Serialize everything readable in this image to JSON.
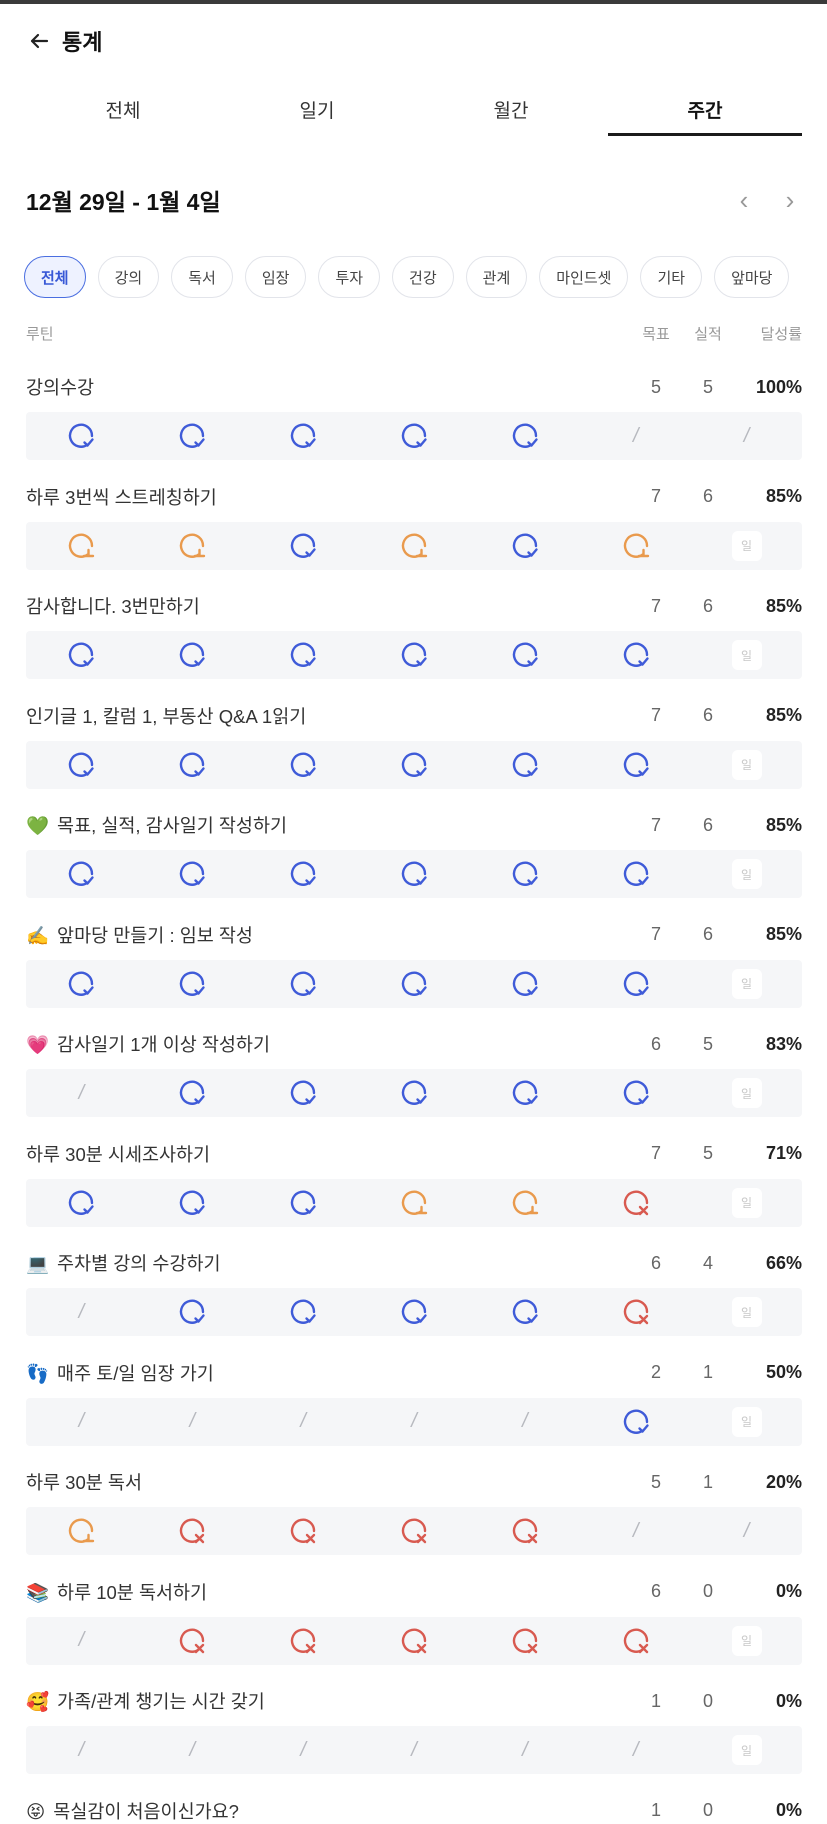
{
  "header": {
    "title": "통계",
    "back_icon": "arrow-left-icon"
  },
  "tabs": [
    "전체",
    "일기",
    "월간",
    "주간"
  ],
  "active_tab": 3,
  "date_range": "12월 29일 - 1월 4일",
  "chips": [
    "전체",
    "강의",
    "독서",
    "임장",
    "투자",
    "건강",
    "관계",
    "마인드셋",
    "기타",
    "앞마당"
  ],
  "active_chip": 0,
  "columns": {
    "routine": "루틴",
    "goal": "목표",
    "actual": "실적",
    "rate": "달성률"
  },
  "colors": {
    "accent": "#3f5bd8",
    "partial": "#e99a4d",
    "fail": "#d85a50",
    "none": "#b7b9bf"
  },
  "routines": [
    {
      "name": "강의수강",
      "goal": "5",
      "actual": "5",
      "rate": "100%",
      "days": [
        "done",
        "done",
        "done",
        "done",
        "done",
        "none",
        "none"
      ]
    },
    {
      "name": "하루 3번씩 스트레칭하기",
      "goal": "7",
      "actual": "6",
      "rate": "85%",
      "days": [
        "partial",
        "partial",
        "done",
        "partial",
        "done",
        "partial",
        "today"
      ]
    },
    {
      "name": "감사합니다. 3번만하기",
      "goal": "7",
      "actual": "6",
      "rate": "85%",
      "days": [
        "done",
        "done",
        "done",
        "done",
        "done",
        "done",
        "today"
      ]
    },
    {
      "name": "인기글 1, 칼럼 1, 부동산 Q&A 1읽기",
      "goal": "7",
      "actual": "6",
      "rate": "85%",
      "days": [
        "done",
        "done",
        "done",
        "done",
        "done",
        "done",
        "today"
      ]
    },
    {
      "emoji": "💚",
      "name": "목표, 실적, 감사일기 작성하기",
      "goal": "7",
      "actual": "6",
      "rate": "85%",
      "days": [
        "done",
        "done",
        "done",
        "done",
        "done",
        "done",
        "today"
      ]
    },
    {
      "emoji": "✍️",
      "name": "앞마당 만들기 : 임보 작성",
      "goal": "7",
      "actual": "6",
      "rate": "85%",
      "days": [
        "done",
        "done",
        "done",
        "done",
        "done",
        "done",
        "today"
      ]
    },
    {
      "emoji": "💗",
      "name": "감사일기 1개 이상 작성하기",
      "goal": "6",
      "actual": "5",
      "rate": "83%",
      "days": [
        "none",
        "done",
        "done",
        "done",
        "done",
        "done",
        "today"
      ]
    },
    {
      "name": "하루 30분 시세조사하기",
      "goal": "7",
      "actual": "5",
      "rate": "71%",
      "days": [
        "done",
        "done",
        "done",
        "partial",
        "partial",
        "fail",
        "today"
      ]
    },
    {
      "emoji": "💻",
      "name": "주차별 강의 수강하기",
      "goal": "6",
      "actual": "4",
      "rate": "66%",
      "days": [
        "none",
        "done",
        "done",
        "done",
        "done",
        "fail",
        "today"
      ]
    },
    {
      "emoji": "👣",
      "name": "매주 토/일 임장 가기",
      "goal": "2",
      "actual": "1",
      "rate": "50%",
      "days": [
        "none",
        "none",
        "none",
        "none",
        "none",
        "done",
        "today"
      ]
    },
    {
      "name": "하루 30분 독서",
      "goal": "5",
      "actual": "1",
      "rate": "20%",
      "days": [
        "partial",
        "fail",
        "fail",
        "fail",
        "fail",
        "none",
        "none"
      ]
    },
    {
      "emoji": "📚",
      "name": "하루 10분 독서하기",
      "goal": "6",
      "actual": "0",
      "rate": "0%",
      "days": [
        "none",
        "fail",
        "fail",
        "fail",
        "fail",
        "fail",
        "today"
      ]
    },
    {
      "emoji": "🥰",
      "name": "가족/관계 챙기는 시간 갖기",
      "goal": "1",
      "actual": "0",
      "rate": "0%",
      "days": [
        "none",
        "none",
        "none",
        "none",
        "none",
        "none",
        "today"
      ]
    },
    {
      "emoji": "😝",
      "name": "목실감이 처음이신가요?",
      "goal": "1",
      "actual": "0",
      "rate": "0%",
      "days": [
        "none",
        "none",
        "none",
        "none",
        "none",
        "none",
        "today"
      ]
    }
  ],
  "today_label": "일",
  "slash": "/"
}
